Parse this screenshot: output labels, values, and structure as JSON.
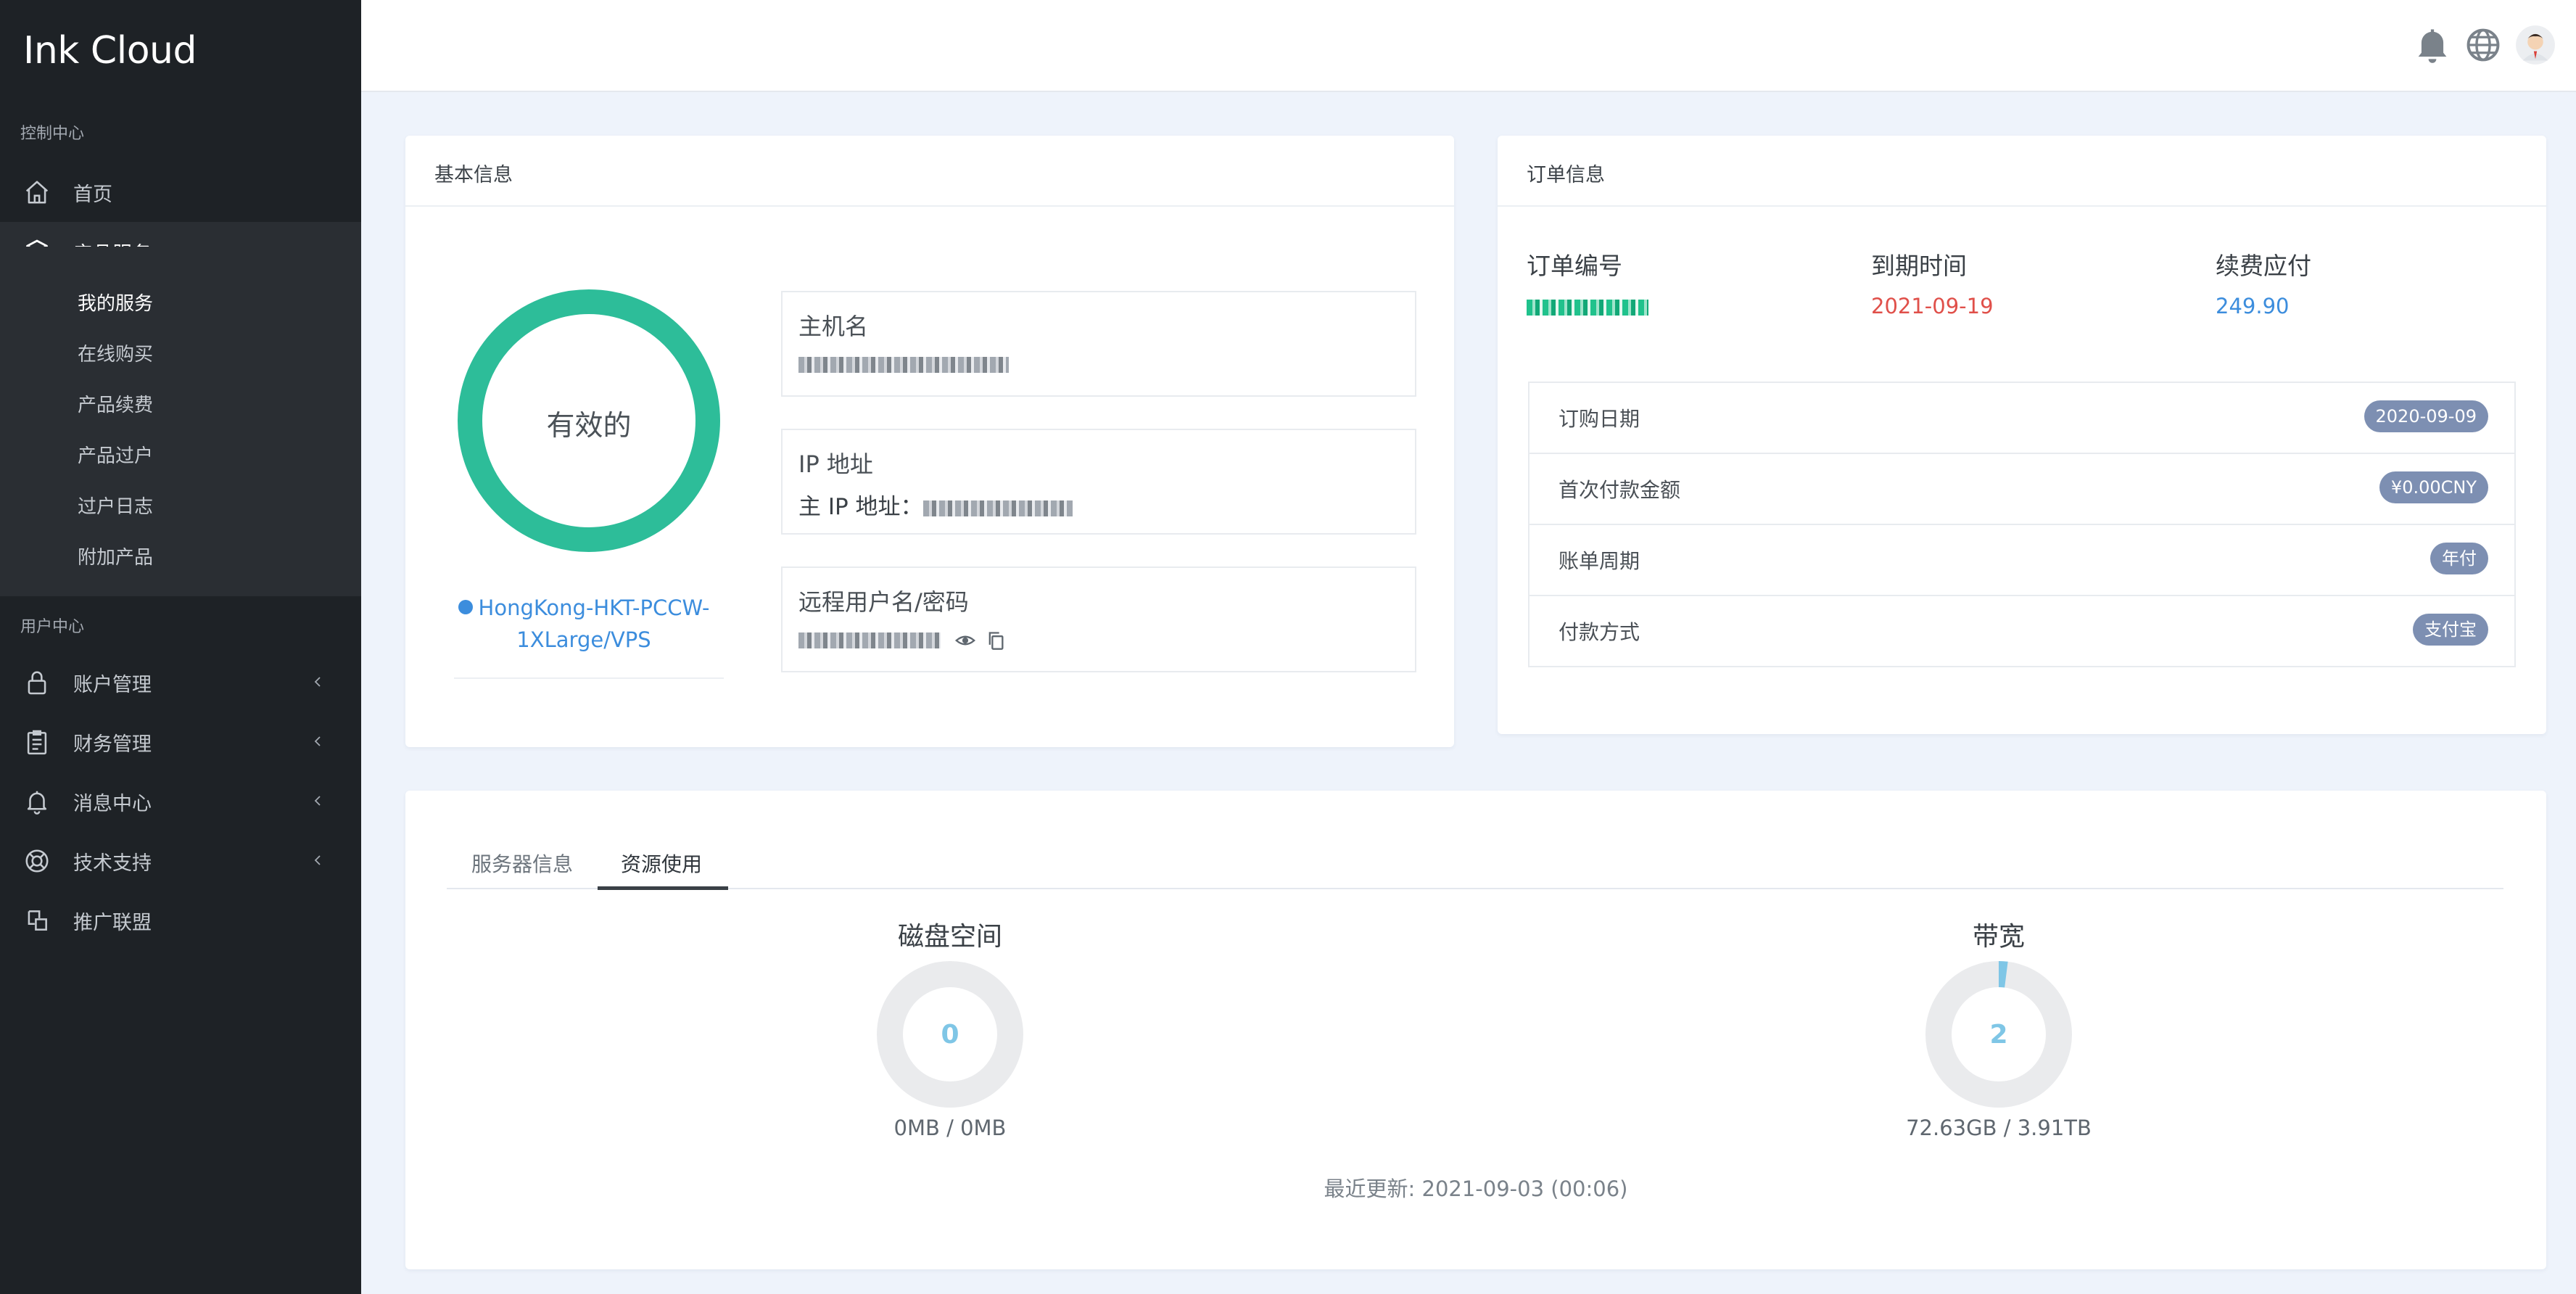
{
  "sidebar": {
    "brand": "Ink Cloud",
    "section_control": "控制中心",
    "section_user": "用户中心",
    "items": {
      "home": "首页",
      "products": "产品服务",
      "account": "账户管理",
      "finance": "财务管理",
      "messages": "消息中心",
      "support": "技术支持",
      "affiliate": "推广联盟"
    },
    "product_sub": [
      "我的服务",
      "在线购买",
      "产品续费",
      "产品过户",
      "过户日志",
      "附加产品"
    ],
    "icons": {
      "home": "home-icon",
      "products": "cube-icon",
      "account": "lock-icon",
      "finance": "clipboard-icon",
      "messages": "bell-icon",
      "support": "lifebuoy-icon",
      "affiliate": "share-icon"
    }
  },
  "header": {
    "icons": [
      "bell-icon",
      "globe-icon",
      "avatar"
    ]
  },
  "basic_info": {
    "title": "基本信息",
    "status": "有效的",
    "status_color": "#2dbd99",
    "product_name": "HongKong-HKT-PCCW-1XLarge/VPS",
    "hostname_label": "主机名",
    "ip_label": "IP 地址",
    "main_ip_label": "主 IP 地址：",
    "remote_label": "远程用户名/密码"
  },
  "order_info": {
    "title": "订单信息",
    "order_no_label": "订单编号",
    "expiry_label": "到期时间",
    "expiry_value": "2021-09-19",
    "renewal_label": "续费应付",
    "renewal_value": "249.90",
    "rows": [
      {
        "key": "订购日期",
        "value": "2020-09-09"
      },
      {
        "key": "首次付款金额",
        "value": "¥0.00CNY"
      },
      {
        "key": "账单周期",
        "value": "年付"
      },
      {
        "key": "付款方式",
        "value": "支付宝"
      }
    ]
  },
  "resources": {
    "tabs": [
      "服务器信息",
      "资源使用"
    ],
    "active_tab": "资源使用",
    "disk": {
      "title": "磁盘空间",
      "center": "0",
      "usage": "0MB / 0MB",
      "fraction": 0
    },
    "bandwidth": {
      "title": "带宽",
      "center": "2",
      "usage": "72.63GB / 3.91TB",
      "fraction": 0.02
    },
    "last_update": "最近更新: 2021-09-03 (00:06)",
    "accent_color": "#7fc6e6"
  }
}
